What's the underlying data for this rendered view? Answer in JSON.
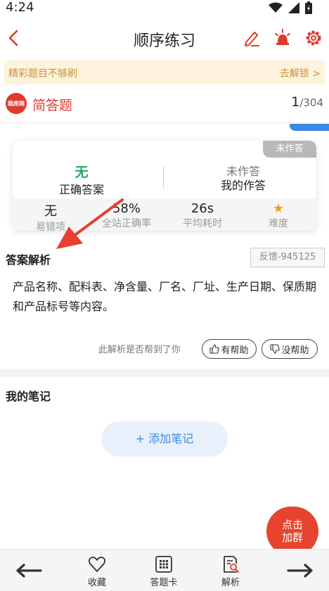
{
  "status_bar": {
    "time": "4:24"
  },
  "header": {
    "title": "顺序练习"
  },
  "banner": {
    "text": "精彩题目不够刷",
    "link": "去解锁 >"
  },
  "question": {
    "logo_text": "题库网",
    "type_label": "简答题",
    "current": "1",
    "total": "/304"
  },
  "answer_card": {
    "status_tag": "未作答",
    "correct_answer_value": "无",
    "correct_answer_label": "正确答案",
    "my_answer_value": "未作答",
    "my_answer_label": "我的作答",
    "stats": [
      {
        "value": "无",
        "label": "易错项"
      },
      {
        "value": "58%",
        "label": "全站正确率"
      },
      {
        "value": "26s",
        "label": "平均耗时"
      },
      {
        "value": "★",
        "label": "难度"
      }
    ]
  },
  "analysis": {
    "title": "答案解析",
    "feedback_label": "反馈-945125",
    "text": "产品名称、配料表、净含量、厂名、厂址、生产日期、保质期和产品标号等内容。",
    "helpful_question": "此解析是否帮到了你",
    "helpful_yes": "有帮助",
    "helpful_no": "没帮助"
  },
  "notes": {
    "title": "我的笔记",
    "add_label": "+ 添加笔记"
  },
  "float_button": {
    "line1": "点击",
    "line2": "加群"
  },
  "bottom_bar": {
    "favorite": "收藏",
    "answer_sheet": "答题卡",
    "analysis": "解析"
  },
  "colors": {
    "accent_red": "#e03a2c",
    "correct_green": "#2aa66b",
    "link_blue": "#3d87e6",
    "banner_text": "#c9923a",
    "star": "#f39c12"
  }
}
